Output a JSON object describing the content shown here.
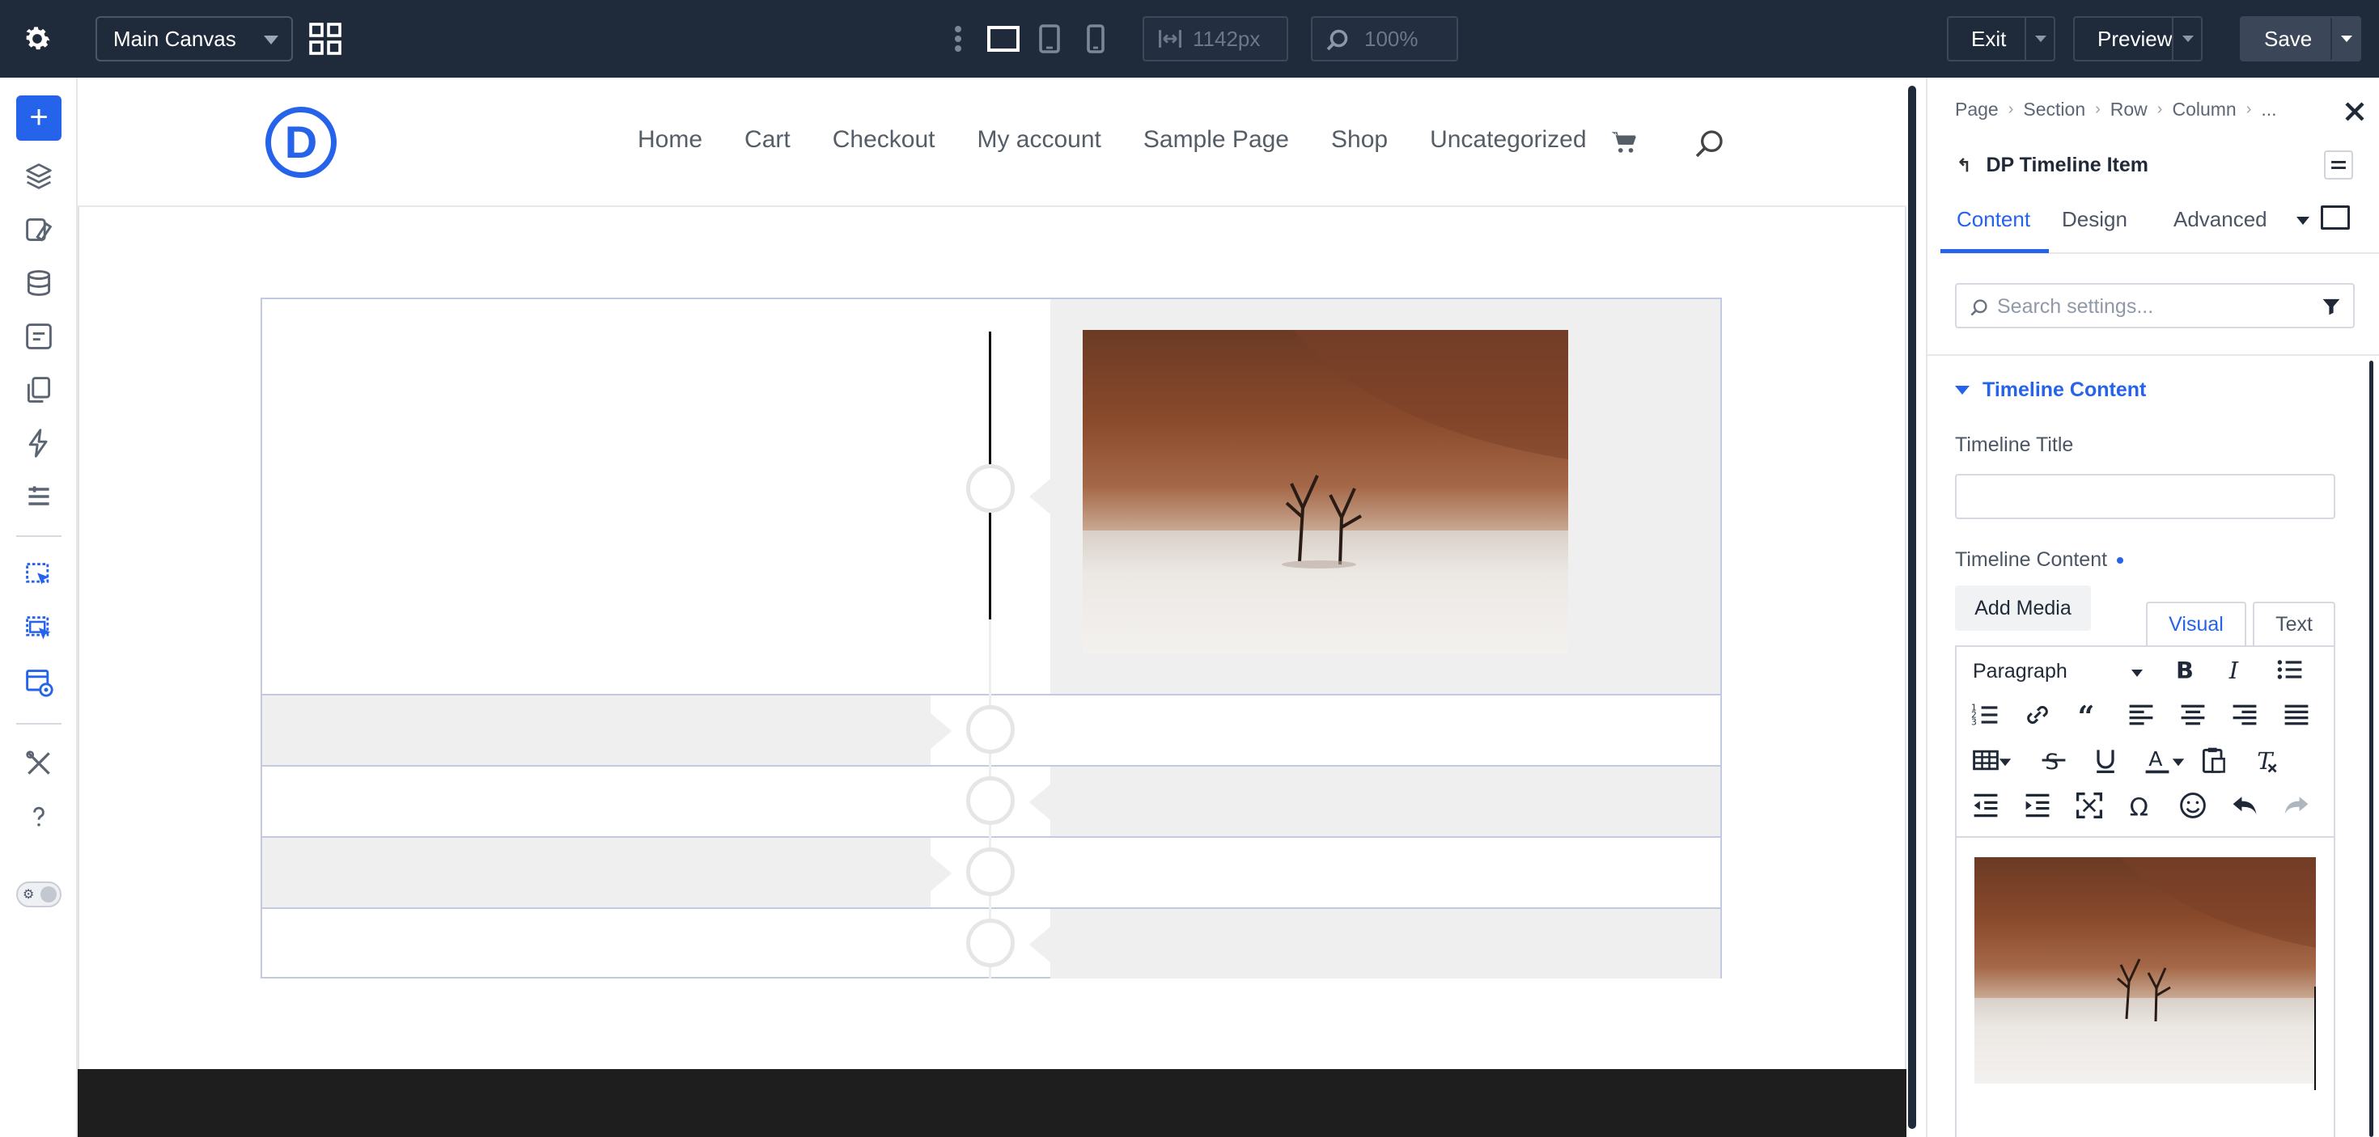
{
  "topbar": {
    "canvas_select": "Main Canvas",
    "width_value": "1142px",
    "zoom_value": "100%",
    "exit_label": "Exit",
    "preview_label": "Preview",
    "save_label": "Save"
  },
  "site": {
    "logo_letter": "D",
    "nav": [
      "Home",
      "Cart",
      "Checkout",
      "My account",
      "Sample Page",
      "Shop",
      "Uncategorized"
    ]
  },
  "panel": {
    "breadcrumbs": [
      "Page",
      "Section",
      "Row",
      "Column",
      "..."
    ],
    "module_title": "DP Timeline Item",
    "tabs": [
      "Content",
      "Design",
      "Advanced"
    ],
    "active_tab": "Content",
    "search_placeholder": "Search settings...",
    "section_title": "Timeline Content",
    "timeline_title_label": "Timeline Title",
    "timeline_title_value": "",
    "timeline_content_label": "Timeline Content",
    "add_media_label": "Add Media",
    "editor_tabs": [
      "Visual",
      "Text"
    ],
    "paragraph_format": "Paragraph"
  },
  "colors": {
    "topbar_bg": "#1f2a3a",
    "accent": "#2563eb",
    "timeline_gray": "#efefef"
  }
}
